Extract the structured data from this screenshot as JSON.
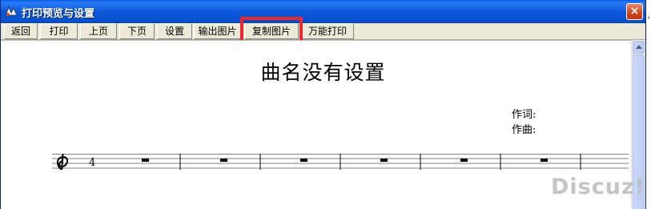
{
  "window": {
    "title": "打印预览与设置",
    "close_glyph": "×"
  },
  "toolbar": {
    "buttons": [
      {
        "label": "返回"
      },
      {
        "label": "打印"
      },
      {
        "label": "上页"
      },
      {
        "label": "下页"
      },
      {
        "label": "设置"
      },
      {
        "label": "输出图片"
      },
      {
        "label": "复制图片"
      },
      {
        "label": "万能打印"
      }
    ],
    "highlighted_button": "复制图片",
    "highlight_color": "#e8272e"
  },
  "score": {
    "title": "曲名没有设置",
    "lyricist_label": "作词:",
    "composer_label": "作曲:",
    "time_signature_top": "4",
    "clef": "treble-clef-icon",
    "measure_rests": 6
  },
  "watermark": {
    "text": "Discuz!"
  },
  "overflow_glyph": "›",
  "colors": {
    "titlebar": "#0b58d9",
    "toolbar_bg": "#ece9d8",
    "close_button": "#d0431b"
  }
}
